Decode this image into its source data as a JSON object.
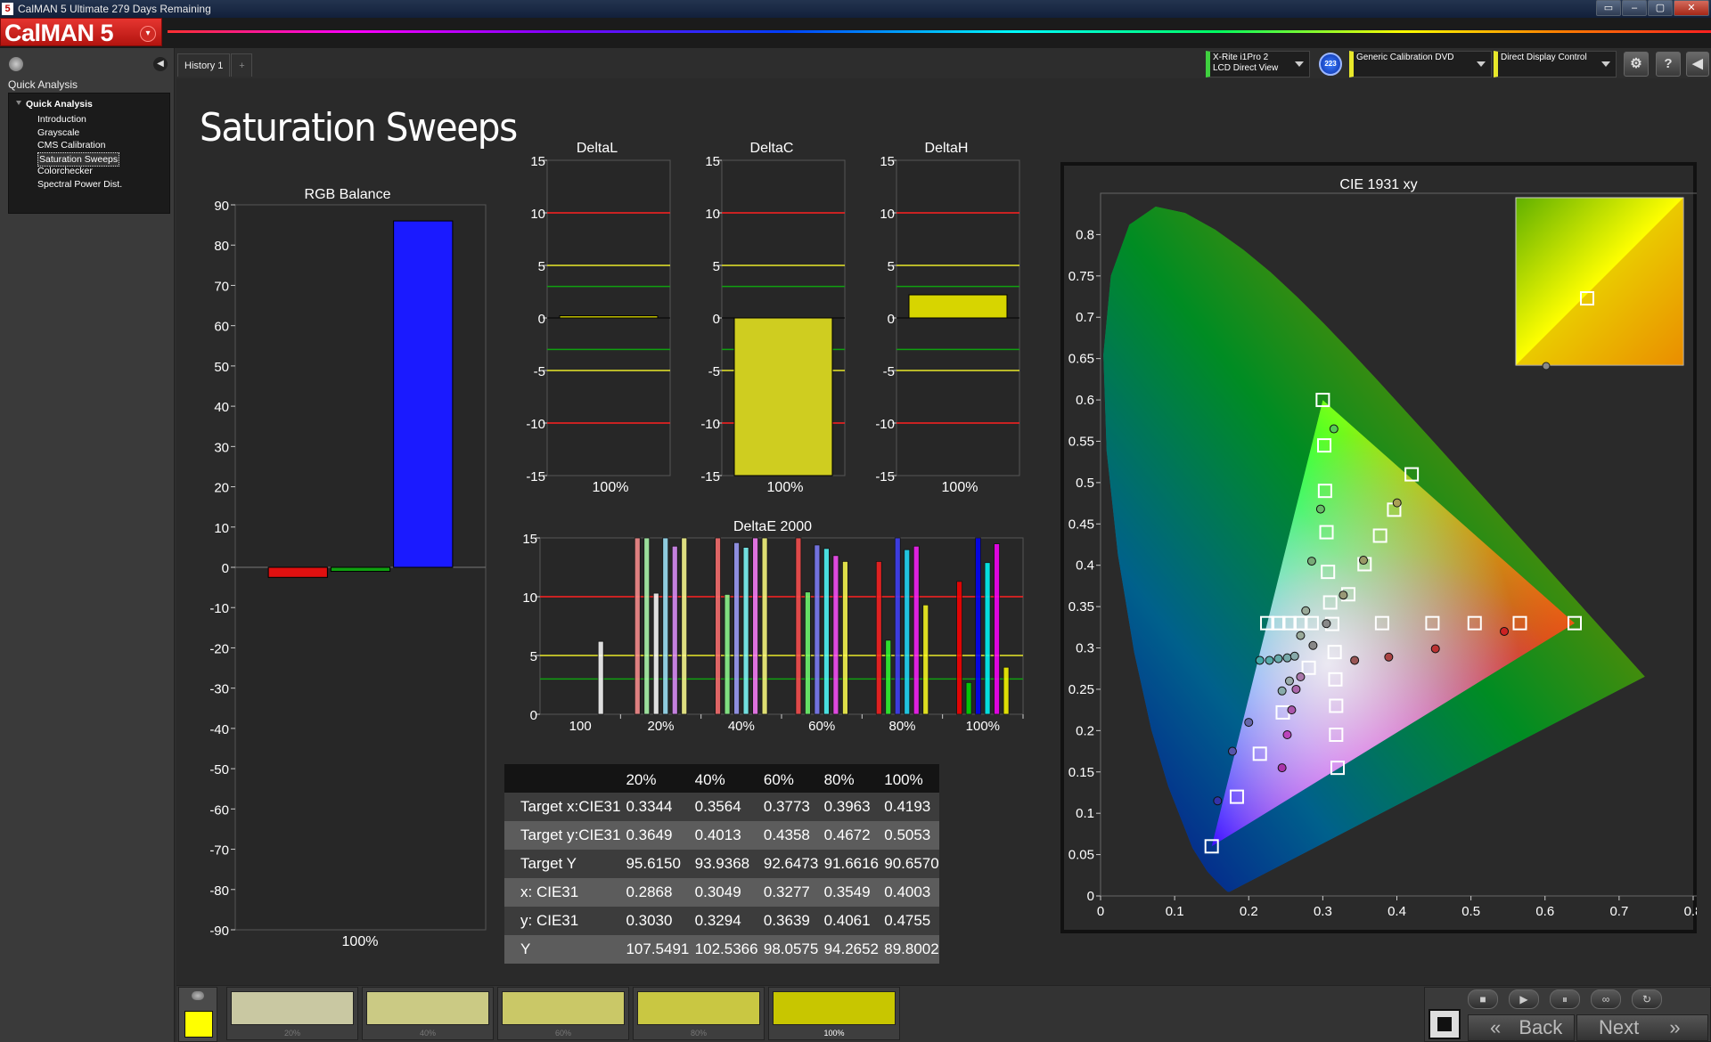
{
  "window": {
    "title": "CalMAN 5 Ultimate 279 Days Remaining",
    "logo_char": "5",
    "controls": [
      "▭",
      "–",
      "▢",
      "✕"
    ]
  },
  "brand": {
    "name": "CalMAN 5",
    "dropdown_glyph": "▾"
  },
  "sidebar": {
    "heading": "Quick Analysis",
    "root": "Quick Analysis",
    "items": [
      "Introduction",
      "Grayscale",
      "CMS Calibration",
      "Saturation Sweeps",
      "Colorchecker",
      "Spectral Power Dist."
    ],
    "selected_index": 3,
    "collapse_glyph": "◀"
  },
  "tabs": [
    {
      "label": "History 1"
    },
    {
      "label": "+"
    }
  ],
  "toolbar": {
    "meter": {
      "line1": "X-Rite i1Pro 2",
      "line2": "LCD Direct View",
      "accent": "#3fd13f"
    },
    "meter_badge": "223",
    "source": {
      "line1": "Generic Calibration DVD",
      "accent": "#e8e82a"
    },
    "display": {
      "line1": "Direct Display Control",
      "accent": "#e8e82a"
    },
    "buttons": [
      "⚙",
      "?",
      "◀"
    ]
  },
  "page": {
    "title": "Saturation Sweeps"
  },
  "charts": {
    "rgb_balance": {
      "type": "bar",
      "title": "RGB Balance",
      "ylim": [
        -90,
        90
      ],
      "yticks": [
        90,
        80,
        70,
        60,
        50,
        40,
        30,
        20,
        10,
        0,
        -10,
        -20,
        -30,
        -40,
        -50,
        -60,
        -70,
        -80,
        -90
      ],
      "category": "100%",
      "series": [
        {
          "name": "red",
          "color": "#e01010",
          "value": -2.5
        },
        {
          "name": "green",
          "color": "#10a010",
          "value": -1
        },
        {
          "name": "blue",
          "color": "#1a1aff",
          "value": 86
        }
      ]
    },
    "delta_l": {
      "type": "bar",
      "title": "DeltaL",
      "ylim": [
        -15,
        15
      ],
      "yticks": [
        15,
        10,
        5,
        0,
        -5,
        -10,
        -15
      ],
      "category": "100%",
      "value": 0.2
    },
    "delta_c": {
      "type": "bar",
      "title": "DeltaC",
      "ylim": [
        -15,
        15
      ],
      "yticks": [
        15,
        10,
        5,
        0,
        -5,
        -10,
        -15
      ],
      "category": "100%",
      "value": -15
    },
    "delta_h": {
      "type": "bar",
      "title": "DeltaH",
      "ylim": [
        -15,
        15
      ],
      "yticks": [
        15,
        10,
        5,
        0,
        -5,
        -10,
        -15
      ],
      "category": "100%",
      "value": 2.2
    },
    "delta_e": {
      "type": "bar",
      "title": "DeltaE 2000",
      "ylim": [
        0,
        15
      ],
      "yticks": [
        15,
        10,
        5,
        0
      ],
      "categories": [
        "100",
        "20%",
        "40%",
        "60%",
        "80%",
        "100%"
      ],
      "groups": [
        [
          {
            "color": "#ffffff",
            "value": 6.2
          }
        ],
        [
          {
            "color": "#ff9090",
            "value": 15
          },
          {
            "color": "#b0ffb0",
            "value": 15
          },
          {
            "color": "#ffffff",
            "value": 10.3
          },
          {
            "color": "#a0e8ff",
            "value": 15
          },
          {
            "color": "#e090ff",
            "value": 14.3
          },
          {
            "color": "#ffff90",
            "value": 15
          }
        ],
        [
          {
            "color": "#ff7070",
            "value": 15
          },
          {
            "color": "#90ff90",
            "value": 10.2
          },
          {
            "color": "#a0a0ff",
            "value": 14.6
          },
          {
            "color": "#80ffff",
            "value": 14.2
          },
          {
            "color": "#ff80ff",
            "value": 15
          },
          {
            "color": "#ffff80",
            "value": 15
          }
        ],
        [
          {
            "color": "#ff5050",
            "value": 15
          },
          {
            "color": "#70ff70",
            "value": 10.4
          },
          {
            "color": "#8080ff",
            "value": 14.4
          },
          {
            "color": "#50ffff",
            "value": 14.1
          },
          {
            "color": "#ff50ff",
            "value": 13.5
          },
          {
            "color": "#ffff50",
            "value": 13
          }
        ],
        [
          {
            "color": "#ff2020",
            "value": 13
          },
          {
            "color": "#30ff30",
            "value": 6.3
          },
          {
            "color": "#4040ff",
            "value": 15
          },
          {
            "color": "#20e0ff",
            "value": 14
          },
          {
            "color": "#ff20ff",
            "value": 14.3
          },
          {
            "color": "#ffff20",
            "value": 9.3
          }
        ],
        [
          {
            "color": "#ff0000",
            "value": 11.3
          },
          {
            "color": "#00e000",
            "value": 2.7
          },
          {
            "color": "#0000ff",
            "value": 15
          },
          {
            "color": "#00ffff",
            "value": 12.9
          },
          {
            "color": "#ff00ff",
            "value": 14.5
          },
          {
            "color": "#ffff00",
            "value": 4
          }
        ]
      ]
    },
    "cie": {
      "type": "scatter",
      "title": "CIE 1931 xy",
      "xlim": [
        0,
        0.8
      ],
      "ylim": [
        0,
        0.85
      ],
      "xticks": [
        0,
        0.1,
        0.2,
        0.3,
        0.4,
        0.5,
        0.6,
        0.7,
        0.8
      ],
      "yticks": [
        0,
        0.05,
        0.1,
        0.15,
        0.2,
        0.25,
        0.3,
        0.35,
        0.4,
        0.45,
        0.5,
        0.55,
        0.6,
        0.65,
        0.7,
        0.75,
        0.8
      ],
      "targets": [
        [
          0.3,
          0.6
        ],
        [
          0.302,
          0.545
        ],
        [
          0.303,
          0.49
        ],
        [
          0.305,
          0.44
        ],
        [
          0.307,
          0.392
        ],
        [
          0.31,
          0.355
        ],
        [
          0.42,
          0.51
        ],
        [
          0.3963,
          0.4672
        ],
        [
          0.3773,
          0.4358
        ],
        [
          0.3564,
          0.4013
        ],
        [
          0.3344,
          0.3649
        ],
        [
          0.64,
          0.33
        ],
        [
          0.566,
          0.33
        ],
        [
          0.505,
          0.33
        ],
        [
          0.448,
          0.33
        ],
        [
          0.38,
          0.33
        ],
        [
          0.15,
          0.06
        ],
        [
          0.184,
          0.12
        ],
        [
          0.215,
          0.172
        ],
        [
          0.246,
          0.222
        ],
        [
          0.281,
          0.276
        ],
        [
          0.225,
          0.33
        ],
        [
          0.24,
          0.33
        ],
        [
          0.255,
          0.33
        ],
        [
          0.27,
          0.33
        ],
        [
          0.285,
          0.33
        ],
        [
          0.32,
          0.155
        ],
        [
          0.318,
          0.195
        ],
        [
          0.318,
          0.23
        ],
        [
          0.317,
          0.262
        ],
        [
          0.316,
          0.295
        ],
        [
          0.3127,
          0.329
        ]
      ],
      "measured": [
        {
          "x": 0.315,
          "y": 0.565,
          "c": "#55cc55"
        },
        {
          "x": 0.297,
          "y": 0.468,
          "c": "#66bb66"
        },
        {
          "x": 0.285,
          "y": 0.405,
          "c": "#77aa77"
        },
        {
          "x": 0.4003,
          "y": 0.4755,
          "c": "#aaa055"
        },
        {
          "x": 0.3549,
          "y": 0.4061,
          "c": "#999966"
        },
        {
          "x": 0.3277,
          "y": 0.3639,
          "c": "#999977"
        },
        {
          "x": 0.3049,
          "y": 0.3294,
          "c": "#888888"
        },
        {
          "x": 0.2868,
          "y": 0.303,
          "c": "#888888"
        },
        {
          "x": 0.545,
          "y": 0.32,
          "c": "#cc2222"
        },
        {
          "x": 0.452,
          "y": 0.299,
          "c": "#bb3333"
        },
        {
          "x": 0.389,
          "y": 0.289,
          "c": "#aa4444"
        },
        {
          "x": 0.343,
          "y": 0.285,
          "c": "#995555"
        },
        {
          "x": 0.158,
          "y": 0.115,
          "c": "#3333aa"
        },
        {
          "x": 0.178,
          "y": 0.175,
          "c": "#5555aa"
        },
        {
          "x": 0.2,
          "y": 0.21,
          "c": "#6666aa"
        },
        {
          "x": 0.215,
          "y": 0.285,
          "c": "#44aaaa"
        },
        {
          "x": 0.228,
          "y": 0.285,
          "c": "#55aaaa"
        },
        {
          "x": 0.24,
          "y": 0.287,
          "c": "#66aaaa"
        },
        {
          "x": 0.252,
          "y": 0.288,
          "c": "#77aaaa"
        },
        {
          "x": 0.262,
          "y": 0.29,
          "c": "#88aaaa"
        },
        {
          "x": 0.27,
          "y": 0.315,
          "c": "#99aa99"
        },
        {
          "x": 0.277,
          "y": 0.345,
          "c": "#99aa99"
        },
        {
          "x": 0.245,
          "y": 0.155,
          "c": "#aa33aa"
        },
        {
          "x": 0.252,
          "y": 0.195,
          "c": "#bb44bb"
        },
        {
          "x": 0.258,
          "y": 0.225,
          "c": "#aa55aa"
        },
        {
          "x": 0.264,
          "y": 0.25,
          "c": "#aa66aa"
        },
        {
          "x": 0.27,
          "y": 0.265,
          "c": "#aa77aa"
        },
        {
          "x": 0.245,
          "y": 0.248,
          "c": "#88aaaa"
        },
        {
          "x": 0.255,
          "y": 0.26,
          "c": "#99aaaa"
        }
      ]
    }
  },
  "table": {
    "headers": [
      "",
      "20%",
      "40%",
      "60%",
      "80%",
      "100%"
    ],
    "rows": [
      {
        "label": "Target x:CIE31",
        "values": [
          "0.3344",
          "0.3564",
          "0.3773",
          "0.3963",
          "0.4193"
        ]
      },
      {
        "label": "Target y:CIE31",
        "values": [
          "0.3649",
          "0.4013",
          "0.4358",
          "0.4672",
          "0.5053"
        ]
      },
      {
        "label": "Target Y",
        "values": [
          "95.6150",
          "93.9368",
          "92.6473",
          "91.6616",
          "90.6570"
        ]
      },
      {
        "label": "x: CIE31",
        "values": [
          "0.2868",
          "0.3049",
          "0.3277",
          "0.3549",
          "0.4003"
        ]
      },
      {
        "label": "y: CIE31",
        "values": [
          "0.3030",
          "0.3294",
          "0.3639",
          "0.4061",
          "0.4755"
        ]
      },
      {
        "label": "Y",
        "values": [
          "107.5491",
          "102.5366",
          "98.0575",
          "94.2652",
          "89.8002"
        ]
      }
    ]
  },
  "patches": [
    {
      "label": "20%",
      "color": "#c9c8a2"
    },
    {
      "label": "40%",
      "color": "#cbca84"
    },
    {
      "label": "60%",
      "color": "#cac867"
    },
    {
      "label": "80%",
      "color": "#c9c742"
    },
    {
      "label": "100%",
      "color": "#c8c600"
    }
  ],
  "current_swatch": "#ffff00",
  "nav": {
    "back": "Back",
    "next": "Next",
    "controls": [
      "■",
      "▶",
      "⏸",
      "∞",
      "↻"
    ],
    "back_glyph": "«",
    "next_glyph": "»"
  }
}
